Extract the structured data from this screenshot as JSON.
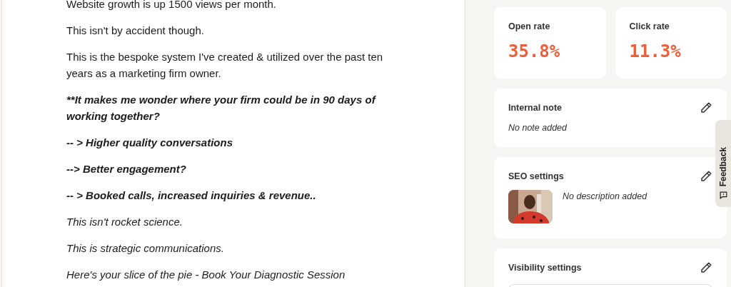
{
  "article": {
    "paragraphs": [
      {
        "kind": "plain",
        "text": "Website growth is up 1500 views per month."
      },
      {
        "kind": "plain",
        "text": "This isn't by accident though."
      },
      {
        "kind": "plain",
        "text": "This is the bespoke system I've created & utilized over the past ten years as a marketing firm owner."
      },
      {
        "kind": "emphasis",
        "text": "**It makes me wonder where your firm could be in 90 days of working together?"
      },
      {
        "kind": "emphasis",
        "text": "-- > Higher quality conversations"
      },
      {
        "kind": "emphasis",
        "text": "--> Better engagement?"
      },
      {
        "kind": "emphasis",
        "text": "-- > Booked calls, increased inquiries & revenue.."
      },
      {
        "kind": "aside",
        "text": "This isn't rocket science."
      },
      {
        "kind": "aside",
        "text": "This is strategic communications."
      },
      {
        "kind": "aside",
        "text": "Here's your slice of the pie - Book Your Diagnostic Session"
      }
    ]
  },
  "stats": [
    {
      "label": "Open rate",
      "value": "35.8%"
    },
    {
      "label": "Click rate",
      "value": "11.3%"
    }
  ],
  "panels": [
    {
      "kind": "note",
      "title": "Internal note",
      "text": "No note added"
    },
    {
      "kind": "seo",
      "title": "SEO settings",
      "text": "No description added"
    },
    {
      "kind": "visibility",
      "title": "Visibility settings"
    }
  ],
  "feedback_tab": {
    "label": "Feedback"
  }
}
